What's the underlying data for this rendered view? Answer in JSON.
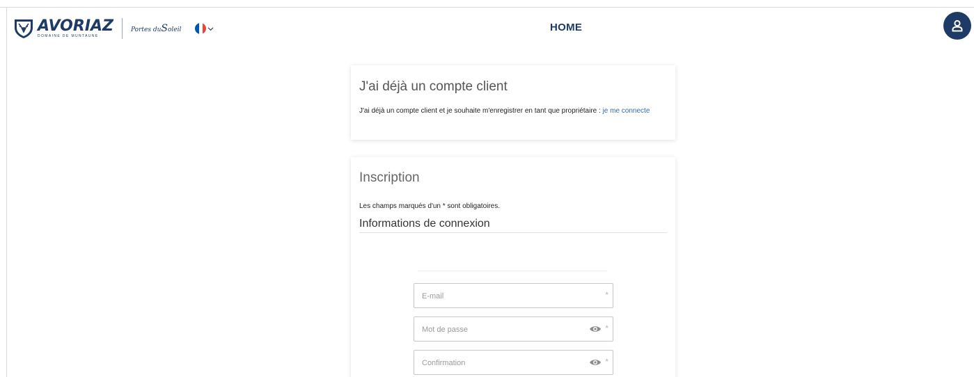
{
  "header": {
    "brand_name": "AVORIAZ",
    "brand_sub": "DOMAINE DE MUNTAUNE",
    "partner_prefix": "Portes du",
    "partner_big": "S",
    "partner_suffix": "oleil",
    "language": "fr",
    "flag_colors": [
      "#0055a4",
      "#ffffff",
      "#ef4135"
    ],
    "title": "HOME",
    "user_icon": "user-icon"
  },
  "existing_account": {
    "title": "J'ai déjà un compte client",
    "text": "J'ai déjà un compte client et je souhaite m'enregistrer en tant que propriétaire : ",
    "link": "je me connecte"
  },
  "signup": {
    "title": "Inscription",
    "required_note": "Les champs marqués d'un * sont obligatoires.",
    "section_title": "Informations de connexion",
    "fields": {
      "email": {
        "placeholder": "E-mail",
        "required_mark": "*"
      },
      "password": {
        "placeholder": "Mot de passe",
        "required_mark": "*",
        "icon": "eye-icon"
      },
      "confirmation": {
        "placeholder": "Confirmation",
        "required_mark": "*",
        "icon": "eye-icon"
      }
    }
  },
  "colors": {
    "brand": "#1e3a66",
    "link": "#2f6cb3"
  }
}
